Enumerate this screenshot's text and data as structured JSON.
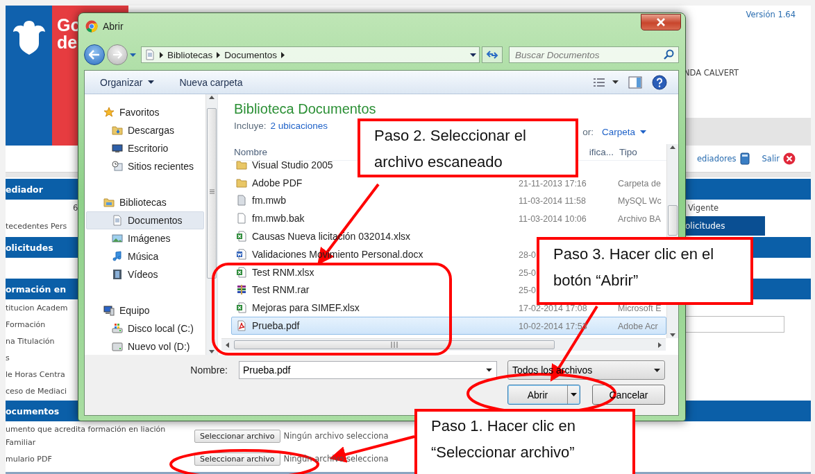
{
  "page": {
    "header": {
      "title_lines": [
        "Go",
        "de"
      ],
      "version": "Versión 1.64",
      "user": "NDA CALVERT"
    },
    "links": [
      {
        "label": "ediadores",
        "kind": "book"
      },
      {
        "label": "Salir",
        "kind": "exit"
      }
    ],
    "sections": [
      {
        "title": "ediador",
        "rows": [
          {
            "value": "6",
            "right": {
              "kind": "text",
              "text": "Vigente"
            }
          },
          {
            "label": "tecedentes Pers",
            "right": {
              "kind": "tab",
              "text": "olicitudes",
              "selected": true
            }
          }
        ]
      },
      {
        "title": "olicitudes"
      },
      {
        "title": "ormación en",
        "rows": [
          {
            "label": "titucion Academ"
          },
          {
            "label": "Formación",
            "right": {
              "kind": "field"
            }
          },
          {
            "label": "na Titulación"
          },
          {
            "label": "s"
          },
          {
            "label": "le Horas Centra"
          },
          {
            "label": "ceso de Mediaci"
          }
        ]
      },
      {
        "title": "ocumentos",
        "rows": [
          {
            "label": "umento que acredita formación en liación Familiar",
            "button": "Seleccionar archivo",
            "status": "Ningún archivo selecciona"
          },
          {
            "label": "mulario PDF",
            "button": "Seleccionar archivo",
            "status": "Ningún archivo selecciona"
          }
        ]
      }
    ]
  },
  "dialog": {
    "title": "Abrir",
    "path": [
      "Bibliotecas",
      "Documentos"
    ],
    "search_placeholder": "Buscar Documentos",
    "toolbar": [
      {
        "label": "Organizar",
        "kind": "menu"
      },
      {
        "label": "Nueva carpeta",
        "kind": "button"
      }
    ],
    "nav": [
      {
        "label": "Favoritos",
        "kind": "star",
        "children": [
          {
            "label": "Descargas",
            "kind": "downloads",
            "selected": false
          },
          {
            "label": "Escritorio",
            "kind": "desktop",
            "selected": false
          },
          {
            "label": "Sitios recientes",
            "kind": "recent",
            "selected": false
          }
        ]
      },
      {
        "label": "Bibliotecas",
        "kind": "library",
        "children": [
          {
            "label": "Documentos",
            "kind": "docs",
            "selected": true
          },
          {
            "label": "Imágenes",
            "kind": "images",
            "selected": false
          },
          {
            "label": "Música",
            "kind": "music",
            "selected": false
          },
          {
            "label": "Vídeos",
            "kind": "video",
            "selected": false
          }
        ]
      },
      {
        "label": "Equipo",
        "kind": "computer",
        "children": [
          {
            "label": "Disco local (C:)",
            "kind": "system_drive",
            "selected": false
          },
          {
            "label": "Nuevo vol (D:)",
            "kind": "drive",
            "selected": false
          }
        ]
      }
    ],
    "library": {
      "title": "Biblioteca Documentos",
      "includes_label": "Incluye:",
      "includes_link": "2 ubicaciones",
      "arrange_label": "or:",
      "arrange_value": "Carpeta"
    },
    "columns": [
      "Nombre",
      "ifica...",
      "Tipo"
    ],
    "files": [
      {
        "name": "Visual Studio 2005",
        "kind": "folder",
        "selected": false
      },
      {
        "name": "Adobe PDF",
        "kind": "folder",
        "date": "21-11-2013 17:16",
        "type": "Carpeta de",
        "selected": false
      },
      {
        "name": "fm.mwb",
        "kind": "mwb",
        "date": "11-03-2014 11:58",
        "type": "MySQL Wc",
        "selected": false
      },
      {
        "name": "fm.mwb.bak",
        "kind": "file",
        "date": "11-03-2014 10:06",
        "type": "Archivo BA",
        "selected": false
      },
      {
        "name": "Causas Nueva licitación 032014.xlsx",
        "kind": "excel",
        "selected": false
      },
      {
        "name": "Validaciones Movimiento Personal.docx",
        "kind": "word",
        "date": "28-0",
        "selected": false
      },
      {
        "name": "Test RNM.xlsx",
        "kind": "excel",
        "date": "25-0",
        "selected": false
      },
      {
        "name": "Test RNM.rar",
        "kind": "rar",
        "date": "25-0",
        "selected": false
      },
      {
        "name": "Mejoras para SIMEF.xlsx",
        "kind": "excel",
        "date": "17-02-2014 17:08",
        "type": "Microsoft E",
        "selected": false
      },
      {
        "name": "Prueba.pdf",
        "kind": "pdf",
        "date": "10-02-2014 17:53",
        "type": "Adobe Acr",
        "selected": true
      }
    ],
    "file_name": {
      "label": "Nombre:",
      "value": "Prueba.pdf"
    },
    "filter": "Todos los archivos",
    "buttons": [
      {
        "label": "Abrir",
        "kind": "split"
      },
      {
        "label": "Cancelar",
        "kind": "plain"
      }
    ]
  },
  "annotations": {
    "callouts": [
      {
        "text": "Paso 2. Seleccionar el archivo escaneado"
      },
      {
        "text": "Paso 3. Hacer clic en el botón “Abrir”"
      },
      {
        "text": "Paso 1. Hacer clic en “Seleccionar archivo”"
      }
    ]
  }
}
